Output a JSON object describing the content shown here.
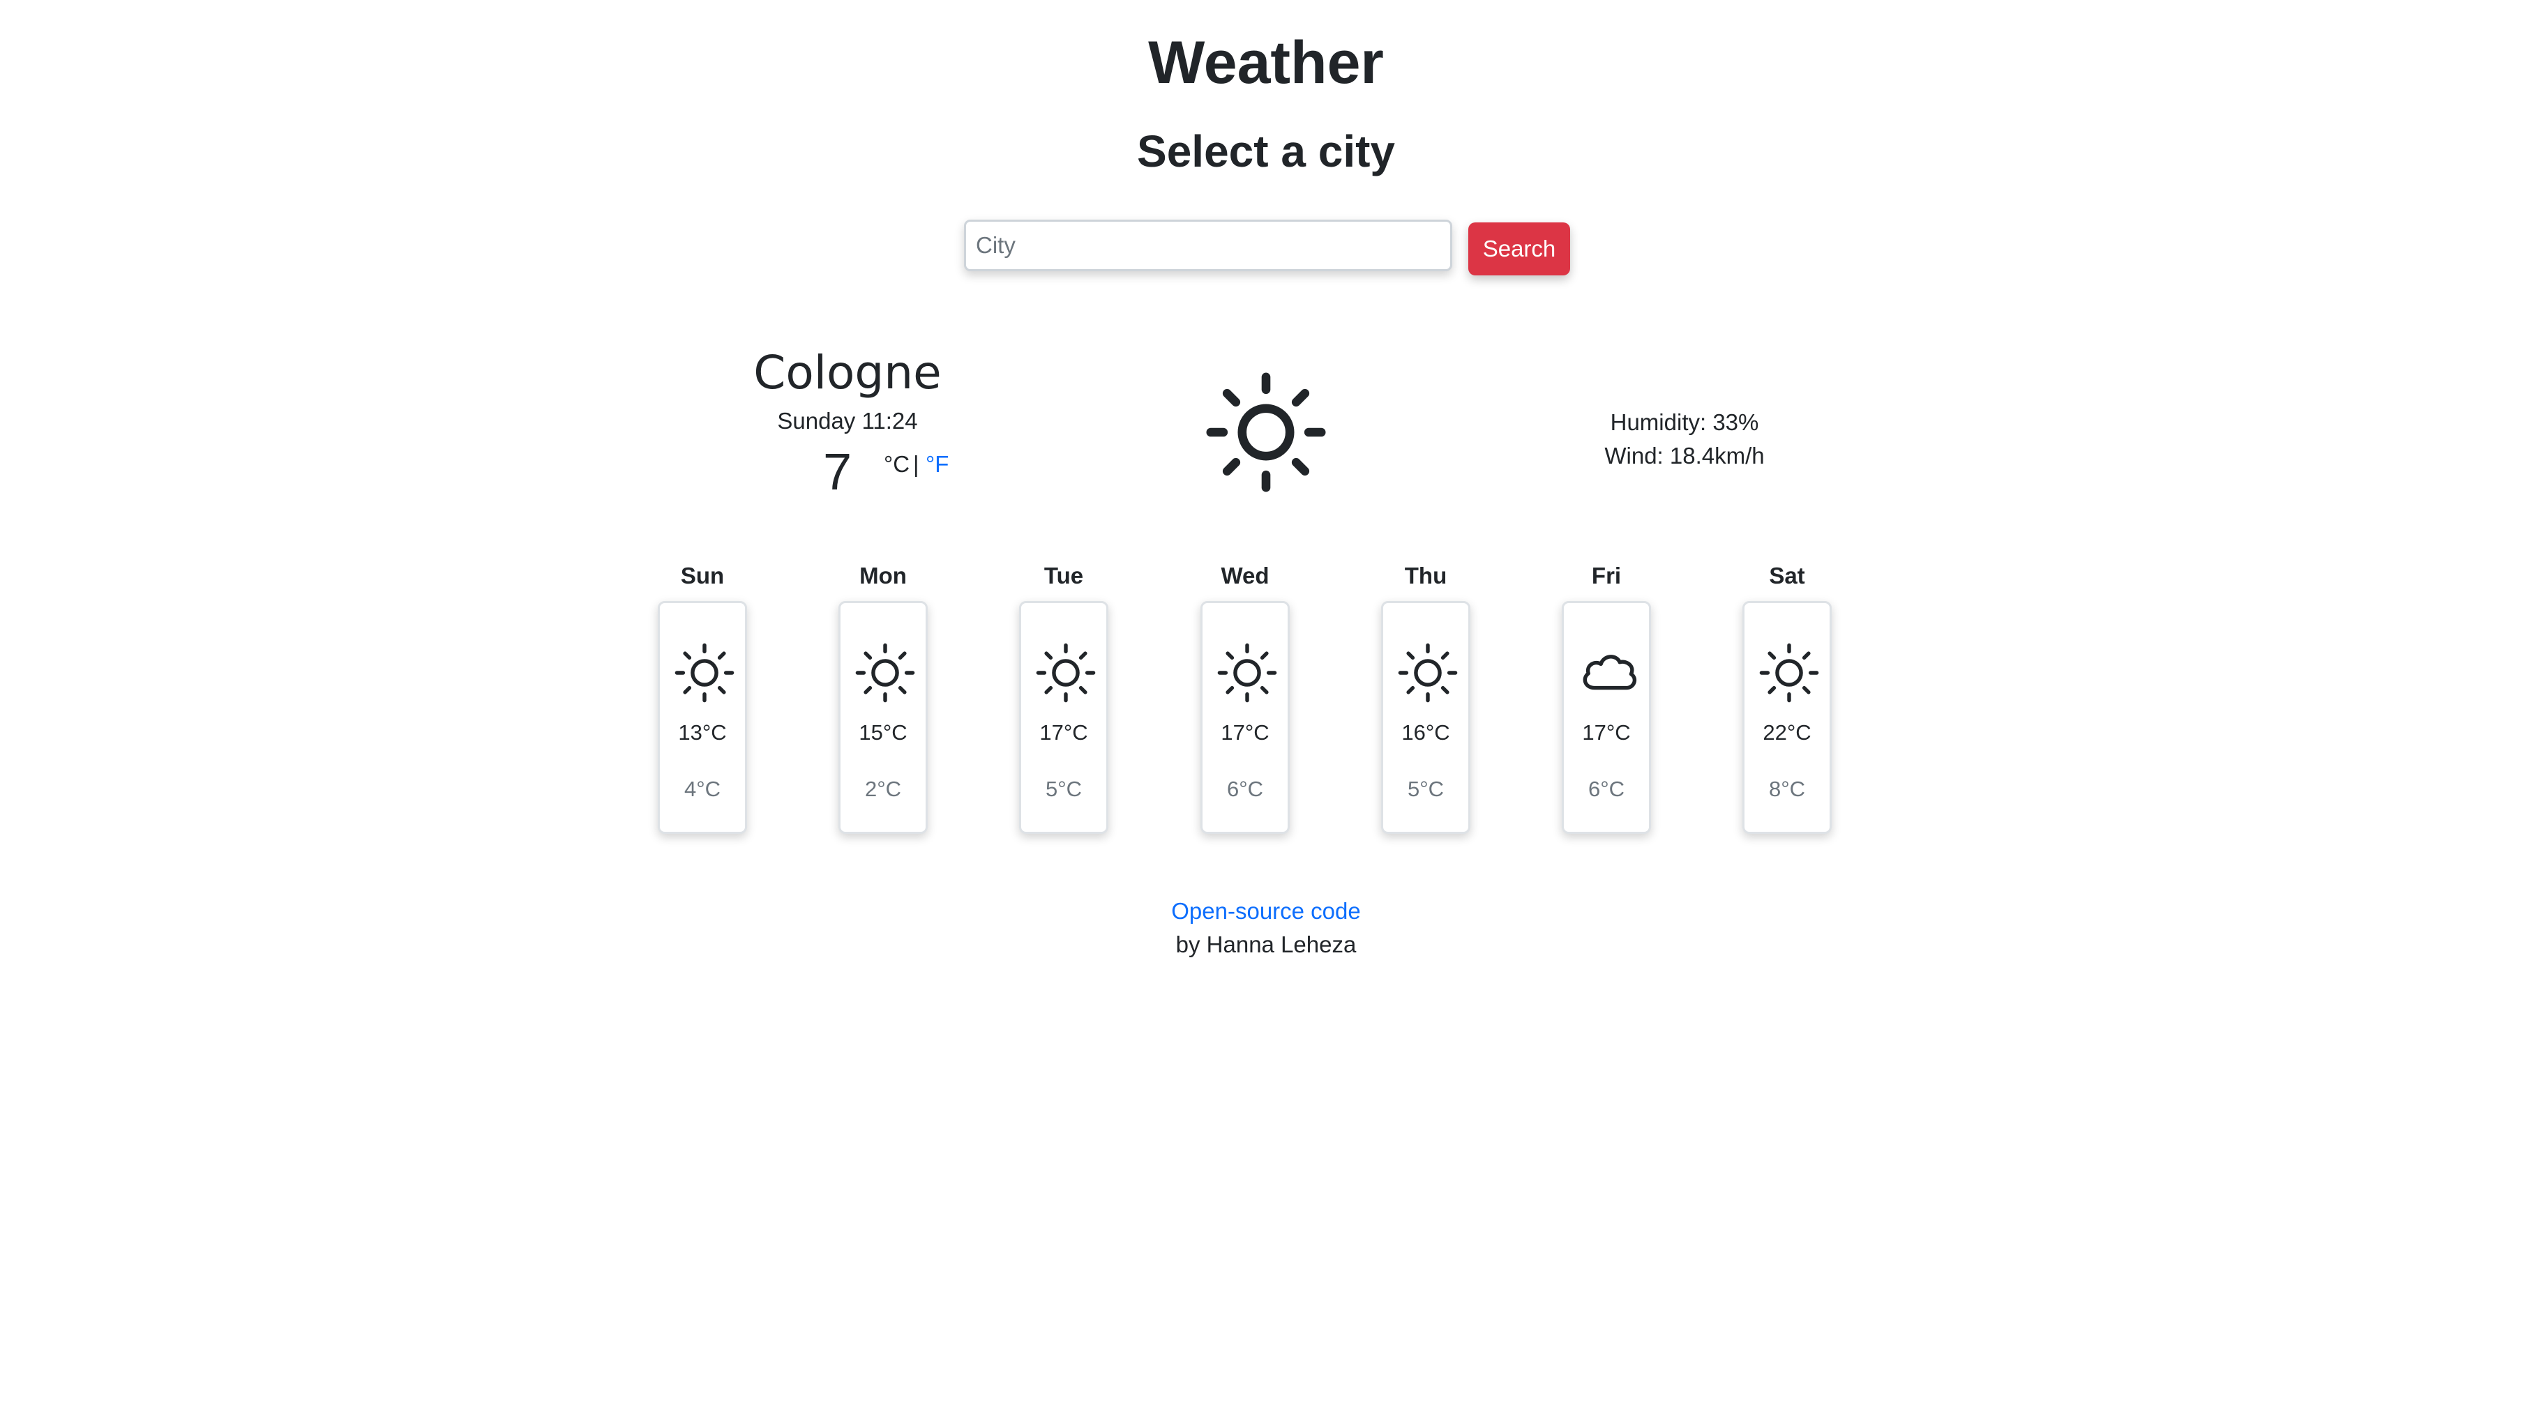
{
  "header": {
    "title": "Weather",
    "subtitle": "Select a city"
  },
  "search": {
    "placeholder": "City",
    "value": "",
    "button_label": "Search"
  },
  "current": {
    "city": "Cologne",
    "date_time": "Sunday 11:24",
    "temperature": "7",
    "unit_celsius": "°C",
    "unit_separator": "|",
    "unit_fahrenheit": "°F",
    "icon": "sun-icon",
    "humidity": "Humidity: 33%",
    "wind": "Wind: 18.4km/h"
  },
  "forecast": [
    {
      "day": "Sun",
      "icon": "sun-icon",
      "max": "13°C",
      "min": "4°C"
    },
    {
      "day": "Mon",
      "icon": "sun-icon",
      "max": "15°C",
      "min": "2°C"
    },
    {
      "day": "Tue",
      "icon": "sun-icon",
      "max": "17°C",
      "min": "5°C"
    },
    {
      "day": "Wed",
      "icon": "sun-icon",
      "max": "17°C",
      "min": "6°C"
    },
    {
      "day": "Thu",
      "icon": "sun-icon",
      "max": "16°C",
      "min": "5°C"
    },
    {
      "day": "Fri",
      "icon": "cloud-icon",
      "max": "17°C",
      "min": "6°C"
    },
    {
      "day": "Sat",
      "icon": "sun-icon",
      "max": "22°C",
      "min": "8°C"
    }
  ],
  "footer": {
    "link_text": "Open-source code",
    "author": "by Hanna Leheza"
  },
  "colors": {
    "accent_button": "#dc3545",
    "link": "#0d6efd",
    "text": "#212529",
    "muted": "#6c757d"
  }
}
